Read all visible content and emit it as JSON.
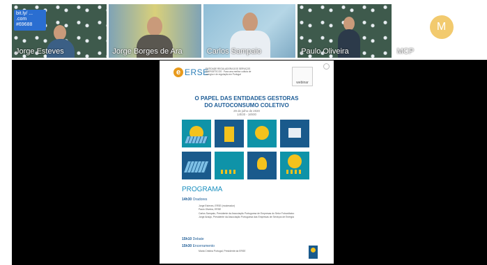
{
  "participants": [
    {
      "name": "Jorge Esteves",
      "chat_badge": "bit.ly/ ... .com\n#69688"
    },
    {
      "name": "Jorge Borges de Ara"
    },
    {
      "name": "Carlos Sampaio"
    },
    {
      "name": "Paulo Oliveira"
    },
    {
      "name": "MCP",
      "avatar_letter": "M"
    }
  ],
  "poster": {
    "logo_letter": "e",
    "logo_word": "ERSE",
    "logo_sub": "ENTIDADE REGULADORA DOS SERVIÇOS ENERGÉTICOS · Para uma melhor cultura de energia e de regulação em Portugal",
    "webinar_label": "webinar",
    "title_line1": "O PAPEL DAS ENTIDADES GESTORAS",
    "title_line2": "DO AUTOCONSUMO COLETIVO",
    "date": "29 de julho de 2020",
    "time": "14h30 - 16h00",
    "programa": "PROGRAMA",
    "rows": [
      {
        "time": "14h30",
        "label": "Oradores"
      },
      {
        "time": "15h10",
        "label": "Debate"
      },
      {
        "time": "15h30",
        "label": "Encerramento"
      }
    ],
    "speakers": [
      "Jorge Esteves, ERSE (moderador)",
      "Paulo Oliveira, ERSE",
      "Carlos Sampaio, Presidente da Associação Portuguesa de Empresas do Setor Fotovoltaico",
      "Jorge Araújo, Presidente da Associação Portuguesa das Empresas de Serviços de Energia"
    ],
    "closing": "Maria Cristina Portugal, Presidente da ERSE"
  },
  "colors": {
    "brand_blue": "#1d5c96",
    "accent_yellow": "#f4c21d",
    "logo_orange": "#e89a1c"
  }
}
